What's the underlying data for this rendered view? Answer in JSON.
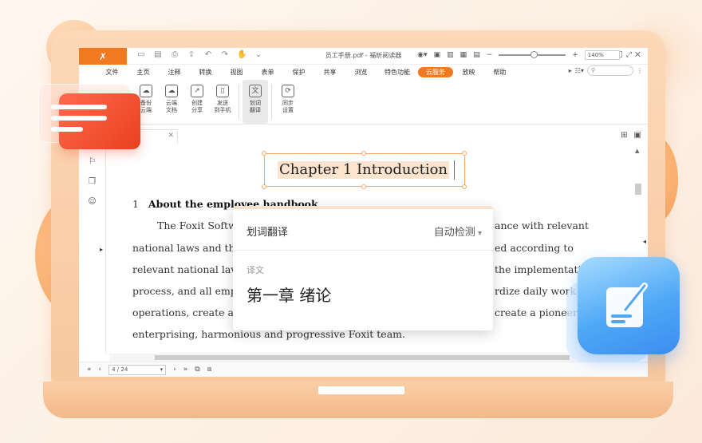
{
  "window": {
    "title": "员工手册.pdf - 福昕阅读器"
  },
  "menu": {
    "items": [
      "文件",
      "主页",
      "注释",
      "转换",
      "视图",
      "表单",
      "保护",
      "共享",
      "浏览",
      "特色功能",
      "云服务",
      "放映",
      "帮助"
    ],
    "active": "云服务",
    "search_icon": "search-icon"
  },
  "ribbon": {
    "buttons": [
      {
        "label1": "备份",
        "label2": "云端",
        "icon": "cloud-backup-icon"
      },
      {
        "label1": "云端",
        "label2": "文档",
        "icon": "cloud-doc-icon"
      },
      {
        "label1": "创建",
        "label2": "分享",
        "icon": "share-icon"
      },
      {
        "label1": "发送",
        "label2": "到手机",
        "icon": "phone-icon"
      },
      {
        "label1": "划词",
        "label2": "翻译",
        "icon": "translate-icon"
      },
      {
        "label1": "同步",
        "label2": "设置",
        "icon": "sync-icon"
      }
    ]
  },
  "document": {
    "heading": "Chapter 1 Introduction",
    "section_num": "1",
    "section_title": "About the employee handbook",
    "line1_left": "The Foxit Softw",
    "line1_right": "ance with relevant",
    "line2_left": "national laws and th",
    "line2_right": "ed according to",
    "line3_left": "relevant national lav",
    "line3_right": "the implementation",
    "line4_left": "process, and all emp",
    "line4_right": "rdize daily work",
    "line5_left": "operations, create a",
    "line5_right": "create a pioneeri",
    "line6": "enterprising, harmonious and progressive Foxit team."
  },
  "popup": {
    "title": "划词翻译",
    "detect": "自动检测",
    "label": "译文",
    "result": "第一章 绪论"
  },
  "status": {
    "page": "4 / 24",
    "zoom": "140%"
  }
}
